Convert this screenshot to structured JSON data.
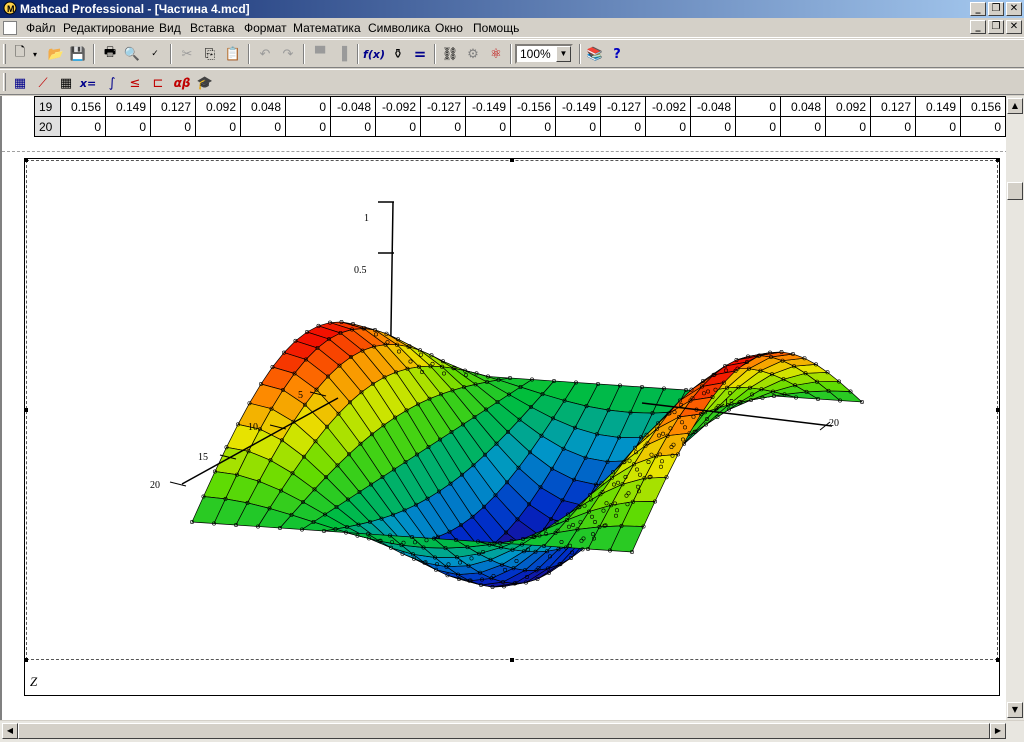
{
  "window": {
    "title": "Mathcad Professional - [Частина 4.mcd]",
    "caption_buttons": [
      "_",
      "❐",
      "✕"
    ],
    "mdi_buttons": [
      "_",
      "❐",
      "✕"
    ]
  },
  "menu": [
    "Файл",
    "Редактирование",
    "Вид",
    "Вставка",
    "Формат",
    "Математика",
    "Символика",
    "Окно",
    "Помощь"
  ],
  "toolbar": {
    "zoom_value": "100%",
    "fx_label": "f(x)",
    "eq_label": "="
  },
  "toolbar2": {
    "xeq_label": "x=",
    "greek_label": "αβ"
  },
  "matrix": {
    "rows": [
      {
        "index": "19",
        "values": [
          "0.156",
          "0.149",
          "0.127",
          "0.092",
          "0.048",
          "0",
          "-0.048",
          "-0.092",
          "-0.127",
          "-0.149",
          "-0.156",
          "-0.149",
          "-0.127",
          "-0.092",
          "-0.048",
          "0",
          "0.048",
          "0.092",
          "0.127",
          "0.149",
          "0.156"
        ]
      },
      {
        "index": "20",
        "values": [
          "0",
          "0",
          "0",
          "0",
          "0",
          "0",
          "0",
          "0",
          "0",
          "0",
          "0",
          "0",
          "0",
          "0",
          "0",
          "0",
          "0",
          "0",
          "0",
          "0",
          "0"
        ]
      }
    ]
  },
  "plot": {
    "variable_label": "Z",
    "z_ticks": [
      "1",
      "0.5"
    ],
    "x_ticks": [
      "5",
      "10",
      "15",
      "20"
    ],
    "y_ticks": [
      "15",
      "20"
    ],
    "colors": {
      "high": "#ff0000",
      "mid": "#00c800",
      "low": "#1a0090"
    }
  },
  "chart_data": {
    "type": "surface",
    "title": "",
    "xlabel": "",
    "ylabel": "",
    "zlabel": "",
    "grid_size": [
      21,
      21
    ],
    "z_axis_ticks": [
      0.5,
      1
    ],
    "x_axis_ticks": [
      5,
      10,
      15,
      20
    ],
    "y_axis_ticks": [
      15,
      20
    ],
    "description_values": {
      "row_19": [
        0.156,
        0.149,
        0.127,
        0.092,
        0.048,
        0,
        -0.048,
        -0.092,
        -0.127,
        -0.149,
        -0.156,
        -0.149,
        -0.127,
        -0.092,
        -0.048,
        0,
        0.048,
        0.092,
        0.127,
        0.149,
        0.156
      ],
      "row_20": [
        0,
        0,
        0,
        0,
        0,
        0,
        0,
        0,
        0,
        0,
        0,
        0,
        0,
        0,
        0,
        0,
        0,
        0,
        0,
        0,
        0
      ]
    },
    "colormap": "jet"
  }
}
